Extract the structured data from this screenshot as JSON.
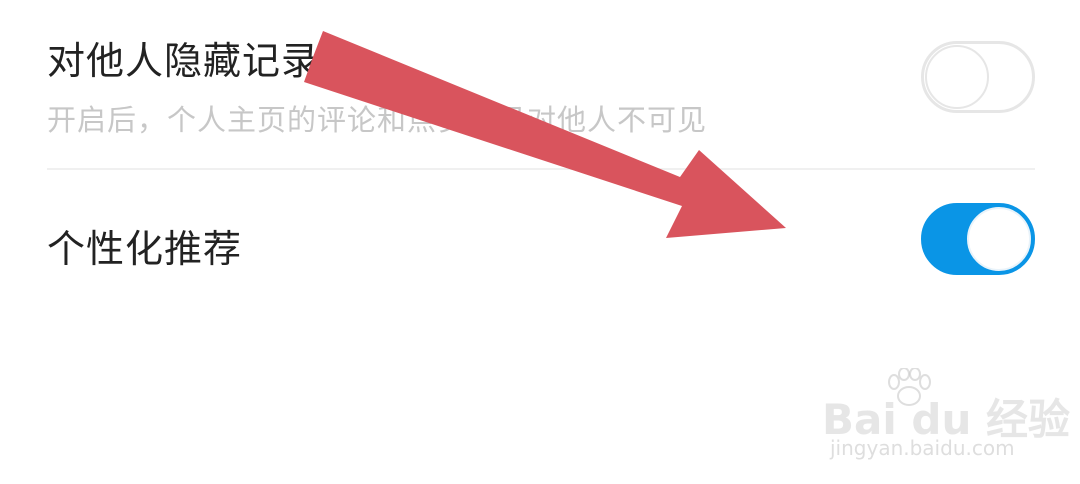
{
  "settings": {
    "hide_records": {
      "title": "对他人隐藏记录",
      "subtitle": "开启后，个人主页的评论和点赞记录对他人不可见",
      "enabled": false
    },
    "personalized_recommend": {
      "title": "个性化推荐",
      "enabled": true
    }
  },
  "colors": {
    "accent": "#0a95e6",
    "arrow": "#d9545d",
    "title_text": "#222222",
    "subtitle_text": "#c7c7c7",
    "toggle_off_border": "#e6e6e6"
  },
  "annotation": {
    "icon": "red-arrow-icon"
  },
  "watermark": {
    "logo_text": "Bai du 经验",
    "url": "jingyan.baidu.com"
  }
}
